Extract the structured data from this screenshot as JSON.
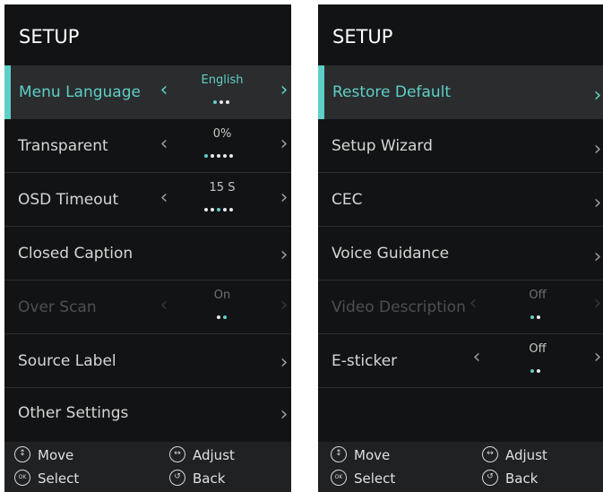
{
  "left_panel": {
    "title": "SETUP",
    "items": [
      {
        "label": "Menu Language",
        "value": "English"
      },
      {
        "label": "Transparent",
        "value": "0%"
      },
      {
        "label": "OSD Timeout",
        "value": "15 S"
      },
      {
        "label": "Closed Caption"
      },
      {
        "label": "Over Scan",
        "value": "On"
      },
      {
        "label": "Source Label"
      },
      {
        "label": "Other Settings"
      }
    ]
  },
  "right_panel": {
    "title": "SETUP",
    "items": [
      {
        "label": "Restore Default"
      },
      {
        "label": "Setup Wizard"
      },
      {
        "label": "CEC"
      },
      {
        "label": "Voice Guidance"
      },
      {
        "label": "Video Description",
        "value": "Off"
      },
      {
        "label": "E-sticker",
        "value": "Off"
      }
    ]
  },
  "footer": {
    "move": "Move",
    "adjust": "Adjust",
    "select": "Select",
    "back": "Back",
    "ok_glyph": "OK"
  },
  "glyphs": {
    "left_chevron": "‹",
    "right_chevron": "›",
    "move_icon": "↕",
    "adjust_icon": "↔",
    "back_icon": "↺"
  },
  "colors": {
    "accent": "#5ecfc6",
    "panel_bg": "#121314",
    "selected_bg": "#2a2c2e",
    "footer_bg": "#1f2123"
  },
  "option_indicators": {
    "menu_language": {
      "count": 3,
      "selected": 1
    },
    "transparent": {
      "count": 5,
      "selected": 1
    },
    "osd_timeout": {
      "count": 5,
      "selected": 3
    },
    "over_scan": {
      "count": 2,
      "selected": 2
    },
    "video_description": {
      "count": 2,
      "selected": 1
    },
    "e_sticker": {
      "count": 2,
      "selected": 1
    }
  },
  "state": {
    "left_selected_item": "Menu Language",
    "right_selected_item": "Restore Default",
    "disabled_items": [
      "Over Scan",
      "Video Description"
    ]
  }
}
